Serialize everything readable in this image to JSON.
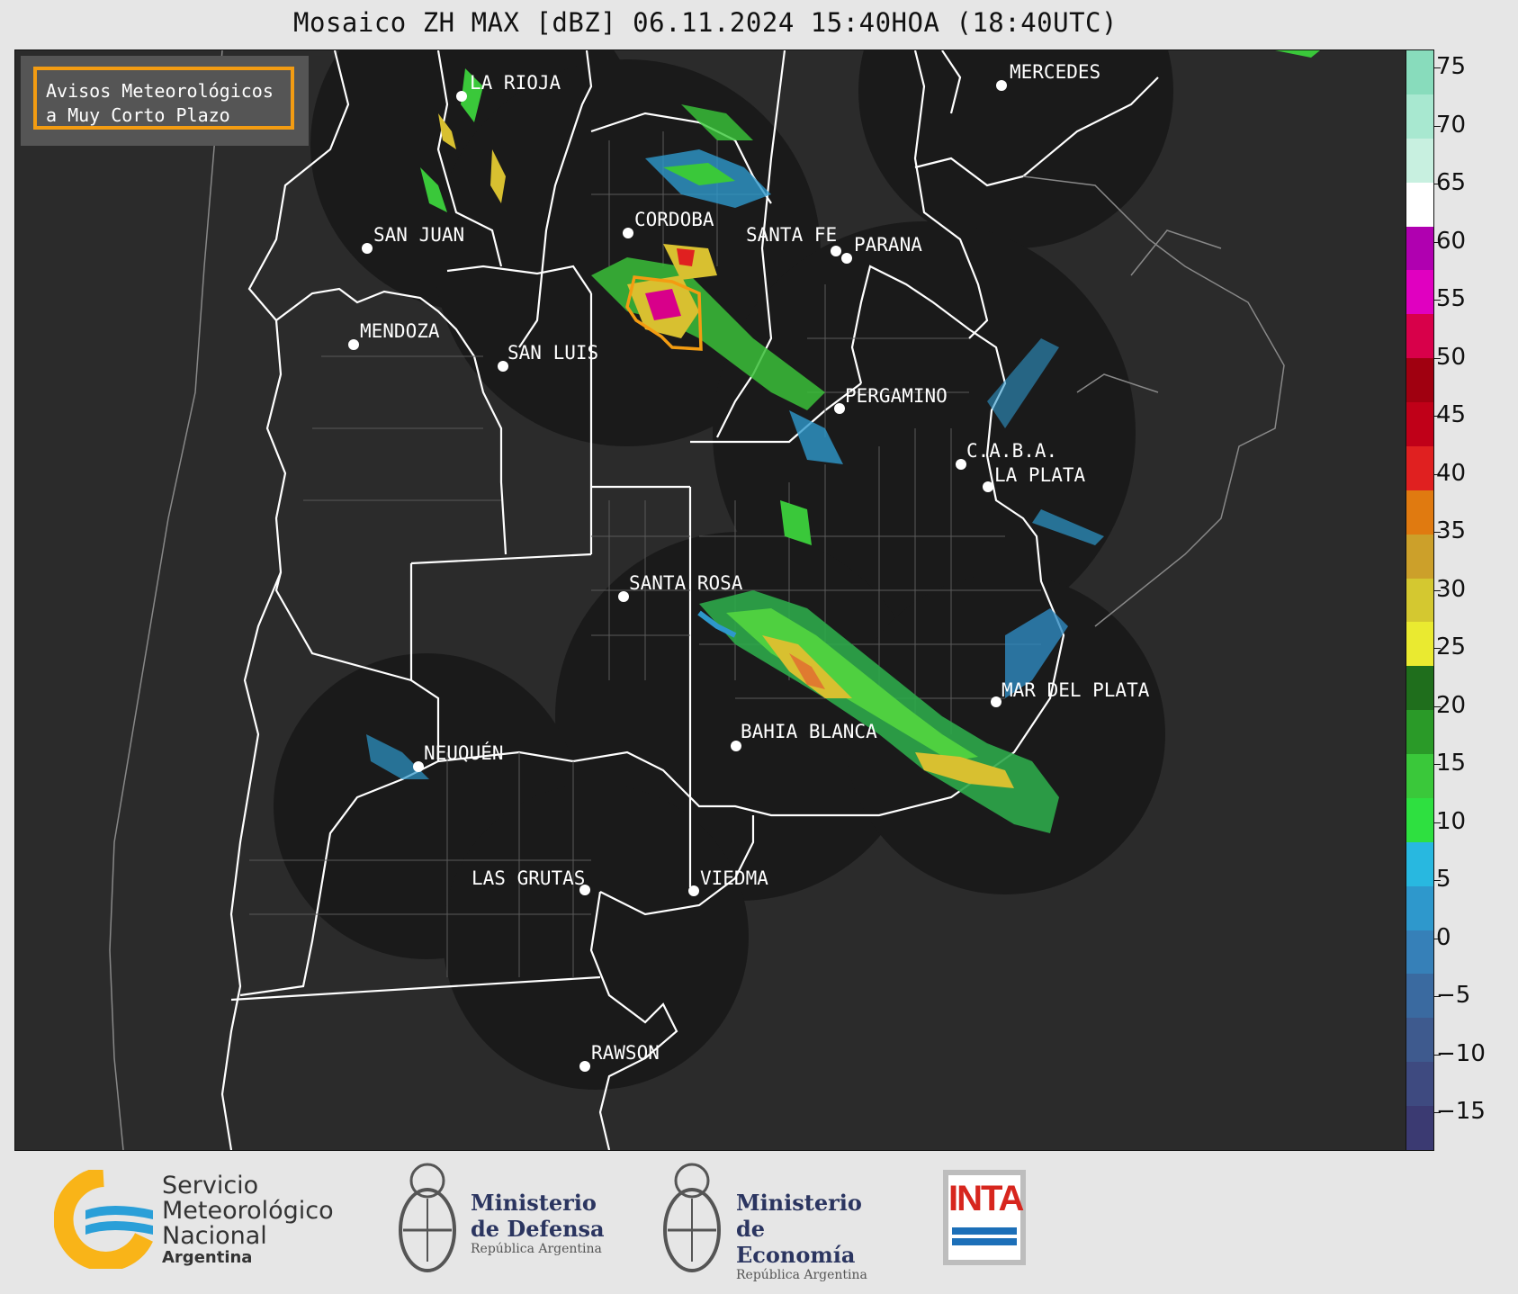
{
  "title": "Mosaico ZH MAX [dBZ] 06.11.2024 15:40HOA (18:40UTC)",
  "warning_box": {
    "line1": "Avisos Meteorológicos",
    "line2": "a Muy Corto Plazo",
    "border_color": "#f39c12"
  },
  "cities": [
    {
      "name": "LA RIOJA"
    },
    {
      "name": "MERCEDES"
    },
    {
      "name": "SAN JUAN"
    },
    {
      "name": "CORDOBA"
    },
    {
      "name": "SANTA FE"
    },
    {
      "name": "PARANA"
    },
    {
      "name": "MENDOZA"
    },
    {
      "name": "SAN LUIS"
    },
    {
      "name": "PERGAMINO"
    },
    {
      "name": "C.A.B.A."
    },
    {
      "name": "LA PLATA"
    },
    {
      "name": "SANTA ROSA"
    },
    {
      "name": "MAR DEL PLATA"
    },
    {
      "name": "BAHIA BLANCA"
    },
    {
      "name": "NEUQUÉN"
    },
    {
      "name": "LAS GRUTAS"
    },
    {
      "name": "VIEDMA"
    },
    {
      "name": "RAWSON"
    }
  ],
  "colorbar": {
    "ticks": [
      "75",
      "70",
      "65",
      "60",
      "55",
      "50",
      "45",
      "40",
      "35",
      "30",
      "25",
      "20",
      "15",
      "10",
      "5",
      "0",
      "−5",
      "−10",
      "−15"
    ],
    "colors": [
      "#3b3a72",
      "#3e4a80",
      "#3e5a8e",
      "#3a6aa0",
      "#3680b8",
      "#2e98cc",
      "#28b8e0",
      "#2ee040",
      "#3ac83a",
      "#2a9a28",
      "#1f6e1c",
      "#eaea30",
      "#d4c830",
      "#cca02a",
      "#e07a10",
      "#e02020",
      "#c00018",
      "#a00010",
      "#d8004a",
      "#e000c0",
      "#b000b0",
      "#ffffff",
      "#c8f0e0",
      "#a8e8d0",
      "#88dcbc"
    ]
  },
  "footer": {
    "smn": {
      "line1": "Servicio",
      "line2": "Meteorológico",
      "line3": "Nacional",
      "line4": "Argentina"
    },
    "defensa": {
      "line1": "Ministerio",
      "line2": "de Defensa",
      "line3": "República Argentina"
    },
    "economia": {
      "line1": "Ministerio",
      "line2": "de Economía",
      "line3": "República Argentina"
    },
    "inta": {
      "label": "INTA"
    }
  }
}
